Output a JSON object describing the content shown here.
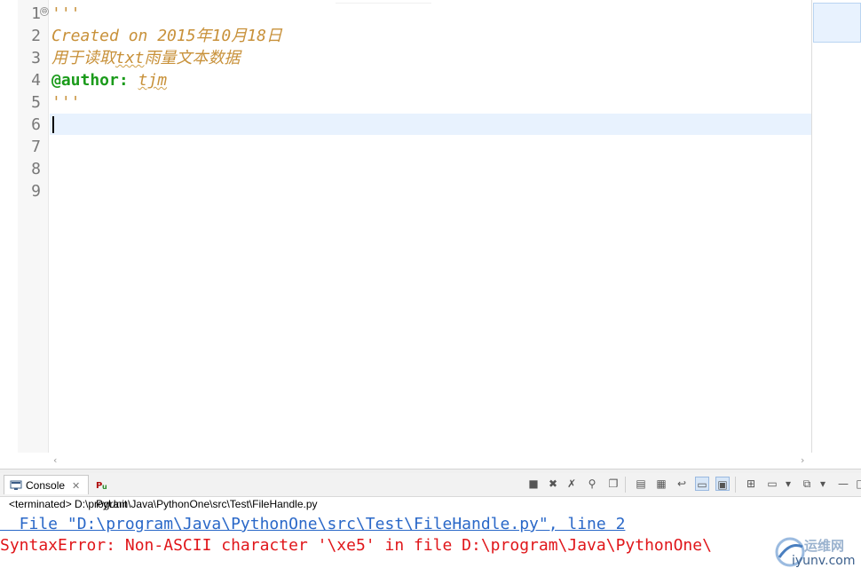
{
  "editor": {
    "line_numbers": [
      "1",
      "2",
      "3",
      "4",
      "5",
      "6",
      "7",
      "8",
      "9"
    ],
    "fold_marker": "⊖",
    "lines": {
      "l1": "'''",
      "l2": "Created on 2015年10月18日",
      "l3_a": "用于读取",
      "l3_b": "txt",
      "l3_c": "雨量文本数据",
      "l4_deco": "@author:",
      "l4_name": "tjm",
      "l5": "'''"
    },
    "scroll_left_arrow": "‹",
    "scroll_right_arrow": "›"
  },
  "console": {
    "tabs": {
      "console_label": "Console",
      "console_close": "✕",
      "pyunit_label": "PyUnit"
    },
    "status": "<terminated> D:\\program\\Java\\PythonOne\\src\\Test\\FileHandle.py",
    "output": {
      "trace_line": "  File \"D:\\program\\Java\\PythonOne\\src\\Test\\FileHandle.py\", line 2",
      "error_line": "SyntaxError: Non-ASCII character '\\xe5' in file D:\\program\\Java\\PythonOne\\"
    },
    "toolbar_icons": [
      "stop-icon",
      "remove-launch-icon",
      "remove-all-icon",
      "pin-icon",
      "display-selected-icon",
      "clear-console-icon",
      "scroll-lock-icon",
      "word-wrap-icon",
      "show-on-output-icon",
      "show-on-error-icon",
      "new-console-icon",
      "minimize-icon",
      "maximize-icon"
    ]
  },
  "watermark": {
    "text_top": "运维网",
    "text_bottom": "iyunv.com"
  },
  "colors": {
    "docstring": "#c8913a",
    "decorator": "#1b9b1b",
    "trace": "#2a68c8",
    "error": "#e0161a",
    "current_line": "#e8f2fe"
  }
}
